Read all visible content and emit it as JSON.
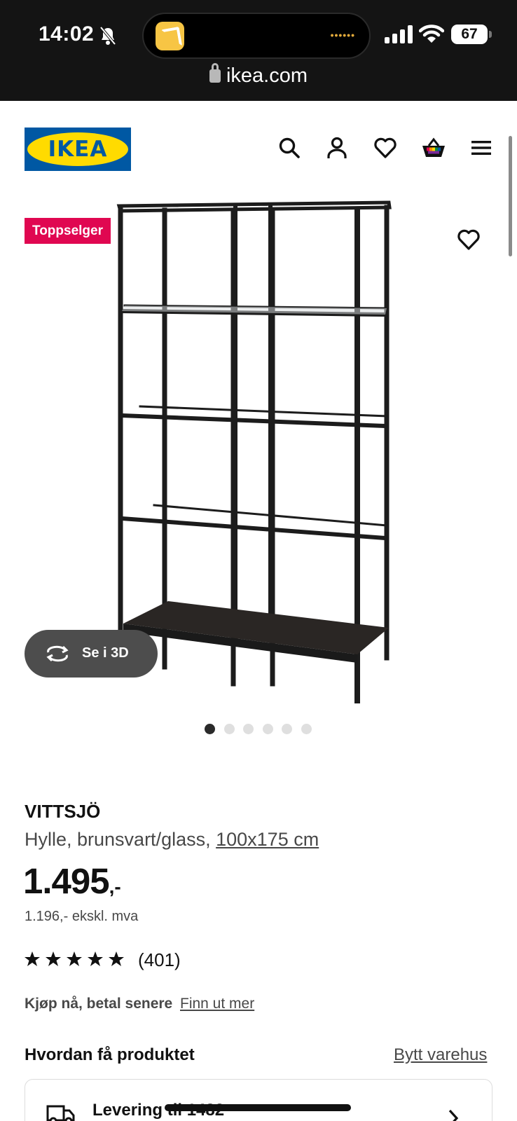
{
  "status_bar": {
    "time": "14:02",
    "battery": "67",
    "island_dots": "••••••"
  },
  "browser": {
    "url": "ikea.com"
  },
  "header": {
    "logo_text": "IKEA",
    "brand_colors": {
      "blue": "#0058a3",
      "yellow": "#ffdb00"
    },
    "icons": [
      "search-icon",
      "account-icon",
      "wishlist-icon",
      "basket-icon",
      "menu-icon"
    ]
  },
  "gallery": {
    "badge": "Toppselger",
    "badge_color": "#e00751",
    "view_3d_label": "Se i 3D",
    "image_count": 6,
    "active_index": 0
  },
  "product": {
    "name": "VITTSJÖ",
    "description": "Hylle, brunsvart/glass, ",
    "dimensions": "100x175 cm",
    "price": "1.495",
    "price_suffix": ",-",
    "price_ex_vat": "1.196,- ekskl. mva",
    "rating_stars": 5,
    "review_count": "(401)",
    "bnpl_label": "Kjøp nå, betal senere",
    "bnpl_link": "Finn ut mer"
  },
  "fulfilment": {
    "heading": "Hvordan få produktet",
    "change_store": "Bytt varehus",
    "delivery_label": "Levering til 1482"
  }
}
